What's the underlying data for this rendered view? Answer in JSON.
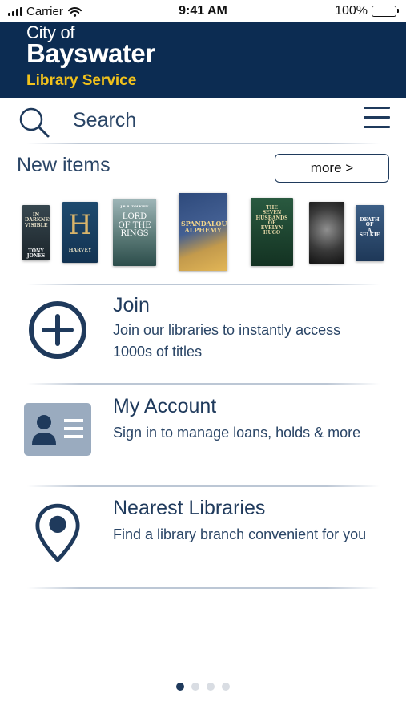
{
  "status_bar": {
    "carrier": "Carrier",
    "time": "9:41 AM",
    "battery": "100%"
  },
  "brand": {
    "line1": "City of",
    "line2": "Bayswater",
    "line3": "Library Service",
    "colors": {
      "header_bg": "#0c2c52",
      "accent": "#f2c21b"
    }
  },
  "search": {
    "label": "Search",
    "icon": "search-icon"
  },
  "new_items": {
    "title": "New items",
    "more_label": "more >",
    "books": [
      {
        "text": "IN DARKNESS VISIBLE\nTONY JONES"
      },
      {
        "text": "H\nHARVEY"
      },
      {
        "text": "LORD OF THE RINGS"
      },
      {
        "text": "SPANDALOUS ALPHEMY"
      },
      {
        "text": "THE SEVEN HUSBANDS OF EVELYN HUGO"
      },
      {
        "text": ""
      },
      {
        "text": "DEATH OF A SELKIE"
      }
    ]
  },
  "menu": [
    {
      "title": "Join",
      "desc": "Join our libraries to instantly access 1000s of titles",
      "icon": "plus-circle-icon"
    },
    {
      "title": "My Account",
      "desc": "Sign in to manage loans, holds & more",
      "icon": "id-card-icon"
    },
    {
      "title": "Nearest Libraries",
      "desc": "Find a library branch convenient for you",
      "icon": "location-pin-icon"
    }
  ],
  "pagination": {
    "active": 1,
    "total": 4
  }
}
